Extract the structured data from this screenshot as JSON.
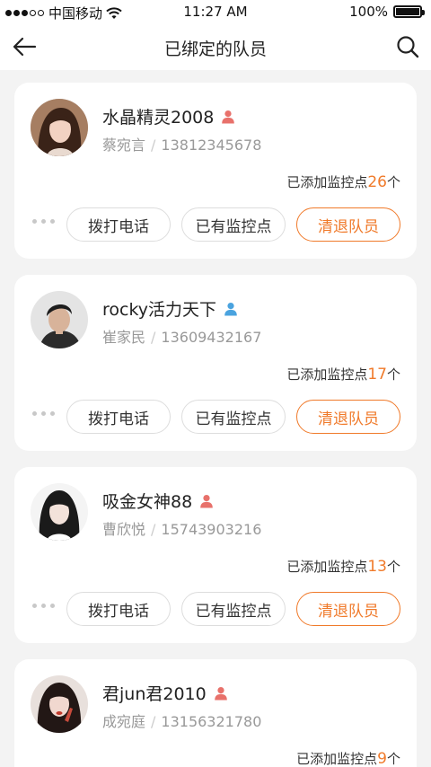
{
  "status_bar": {
    "carrier": "中国移动",
    "time": "11:27 AM",
    "battery": "100%"
  },
  "header": {
    "title": "已绑定的队员"
  },
  "labels": {
    "added_prefix": "已添加监控点",
    "added_suffix": "个",
    "call_button": "拨打电话",
    "points_button": "已有监控点",
    "remove_button": "清退队员",
    "separator": "/"
  },
  "colors": {
    "accent": "#f07a2a",
    "female_icon": "#e8716b",
    "male_icon": "#4aa3df"
  },
  "members": [
    {
      "nickname": "水晶精灵2008",
      "gender": "female",
      "real_name": "蔡宛言",
      "phone": "13812345678",
      "points": "26"
    },
    {
      "nickname": "rocky活力天下",
      "gender": "male",
      "real_name": "崔家民",
      "phone": "13609432167",
      "points": "17"
    },
    {
      "nickname": "吸金女神88",
      "gender": "female",
      "real_name": "曹欣悦",
      "phone": "15743903216",
      "points": "13"
    },
    {
      "nickname": "君jun君2010",
      "gender": "female",
      "real_name": "成宛庭",
      "phone": "13156321780",
      "points": "9"
    }
  ]
}
